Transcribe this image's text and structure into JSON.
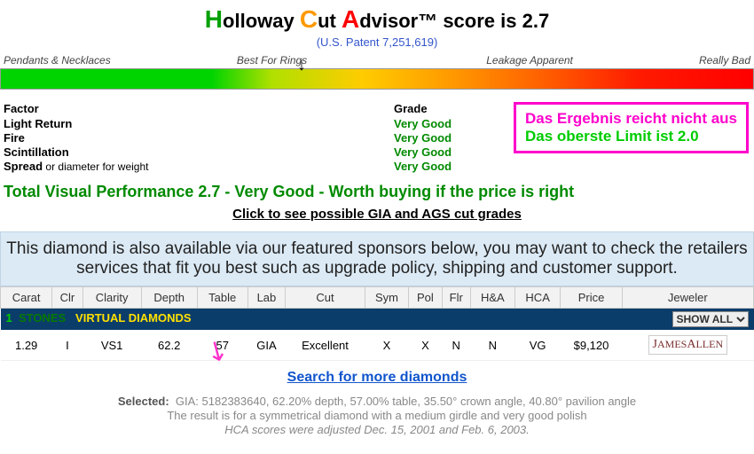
{
  "header": {
    "title_full": "Holloway Cut Advisor™ score is 2.7",
    "title_H": "H",
    "title_olloway": "olloway ",
    "title_C": "C",
    "title_ut": "ut ",
    "title_A": "A",
    "title_rest": "dvisor™ score is 2.7",
    "patent": "(U.S. Patent 7,251,619)"
  },
  "scale": {
    "labels": [
      "Pendants & Necklaces",
      "Best For Rings",
      "Leakage Apparent",
      "Really Bad"
    ],
    "arrow_percent": 40
  },
  "factors": {
    "head_factor": "Factor",
    "head_grade": "Grade",
    "rows": [
      {
        "name": "Light Return",
        "suffix": "",
        "grade": "Very Good"
      },
      {
        "name": "Fire",
        "suffix": "",
        "grade": "Very Good"
      },
      {
        "name": "Scintillation",
        "suffix": "",
        "grade": "Very Good"
      },
      {
        "name": "Spread",
        "suffix": " or diameter for weight",
        "grade": "Very Good"
      }
    ]
  },
  "pinkbox": {
    "line1": "Das Ergebnis reicht nicht aus",
    "line2": "Das oberste Limit ist 2.0"
  },
  "tvp": "Total Visual Performance 2.7 - Very Good - Worth buying if the price is right",
  "possible_link": "Click to see possible GIA and AGS cut grades",
  "sponsor_text": "This diamond is also available via our featured sponsors below, you may want to check the retailers services that fit you best such as upgrade policy, shipping and customer support.",
  "table": {
    "headers": [
      "Carat",
      "Clr",
      "Clarity",
      "Depth",
      "Table",
      "Lab",
      "Cut",
      "Sym",
      "Pol",
      "Flr",
      "H&A",
      "HCA",
      "Price",
      "Jeweler"
    ],
    "band_count": "1",
    "band_stones": "STONES",
    "band_virtual": "VIRTUAL  DIAMONDS",
    "showall": "SHOW ALL",
    "row": {
      "carat": "1.29",
      "clr": "I",
      "clarity": "VS1",
      "depth": "62.2",
      "table": "57",
      "lab": "GIA",
      "cut": "Excellent",
      "sym": "X",
      "pol": "X",
      "flr": "N",
      "ha": "N",
      "hca": "VG",
      "price": "$9,120",
      "jeweler": "JAMES ALLEN"
    }
  },
  "search_more": "Search for more diamonds",
  "footer": {
    "selected_label": "Selected:",
    "selected_detail": "GIA: 5182383640, 62.20% depth, 57.00% table, 35.50° crown angle, 40.80° pavilion angle",
    "line2": "The result is for a symmetrical diamond with a medium girdle and very good polish",
    "line3": "HCA scores were adjusted Dec. 15, 2001 and Feb. 6, 2003."
  }
}
